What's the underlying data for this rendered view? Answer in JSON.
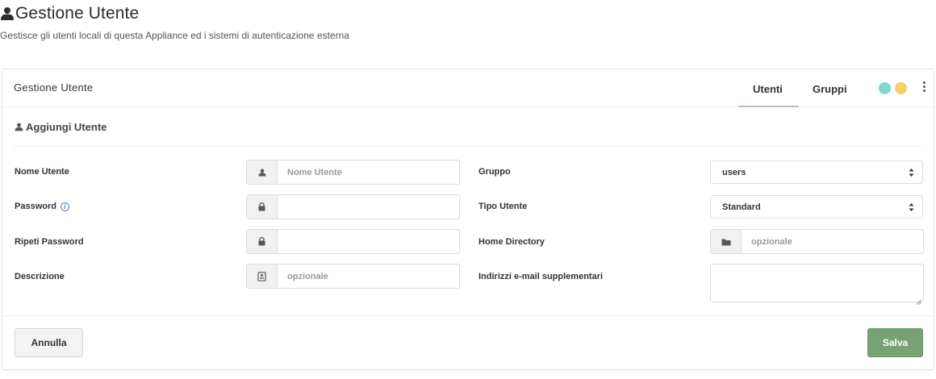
{
  "page": {
    "title": "Gestione Utente",
    "subtitle": "Gestisce gli utenti locali di questa Appliance ed i sistemi di autenticazione esterna",
    "title_icon": "user-icon"
  },
  "panel": {
    "title": "Gestione Utente",
    "tabs": [
      {
        "label": "Utenti",
        "active": true
      },
      {
        "label": "Gruppi",
        "active": false
      }
    ],
    "status_dots": [
      {
        "color": "#7fd6cc"
      },
      {
        "color": "#f4cf6a"
      }
    ],
    "menu_icon": "kebab-menu-icon"
  },
  "section": {
    "title": "Aggiungi Utente",
    "icon": "user-icon"
  },
  "form": {
    "nome_utente": {
      "label": "Nome Utente",
      "placeholder": "Nome Utente",
      "value": "",
      "icon": "user-icon"
    },
    "password": {
      "label": "Password",
      "value": "",
      "icon": "lock-icon",
      "info_icon": "info-icon"
    },
    "ripeti_password": {
      "label": "Ripeti Password",
      "value": "",
      "icon": "lock-icon"
    },
    "descrizione": {
      "label": "Descrizione",
      "placeholder": "opzionale",
      "value": "",
      "icon": "address-card-icon"
    },
    "gruppo": {
      "label": "Gruppo",
      "selected": "users"
    },
    "tipo_utente": {
      "label": "Tipo Utente",
      "selected": "Standard"
    },
    "home_directory": {
      "label": "Home Directory",
      "placeholder": "opzionale",
      "value": "",
      "icon": "folder-icon"
    },
    "email_supplementari": {
      "label": "Indirizzi e-mail supplementari",
      "value": ""
    }
  },
  "footer": {
    "cancel_label": "Annulla",
    "save_label": "Salva"
  },
  "colors": {
    "save_button": "#76a276",
    "tab_underline": "#b8b8d8",
    "info": "#4a7fd0"
  }
}
